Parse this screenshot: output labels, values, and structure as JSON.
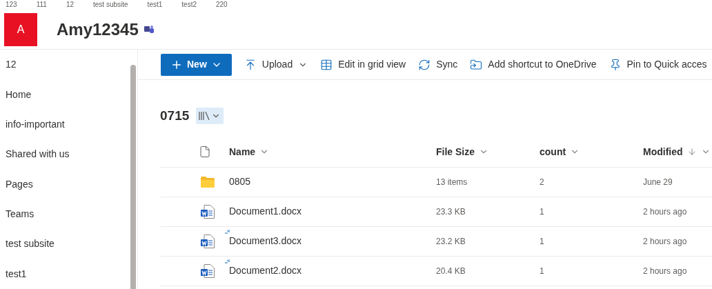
{
  "top_nav": [
    "123",
    "111",
    "12",
    "test subsite",
    "test1",
    "test2",
    "220"
  ],
  "site": {
    "logo_letter": "A",
    "title": "Amy12345"
  },
  "sidebar": {
    "items": [
      {
        "label": "12"
      },
      {
        "label": "Home"
      },
      {
        "label": "info-important"
      },
      {
        "label": "Shared with us"
      },
      {
        "label": "Pages"
      },
      {
        "label": "Teams"
      },
      {
        "label": "test subsite"
      },
      {
        "label": "test1"
      }
    ]
  },
  "toolbar": {
    "new_button": "New",
    "actions": [
      {
        "kind": "upload",
        "label": "Upload",
        "dropdown": true
      },
      {
        "kind": "grid",
        "label": "Edit in grid view",
        "dropdown": false
      },
      {
        "kind": "sync",
        "label": "Sync",
        "dropdown": false
      },
      {
        "kind": "shortcut",
        "label": "Add shortcut to OneDrive",
        "dropdown": false
      },
      {
        "kind": "pin",
        "label": "Pin to Quick acces",
        "dropdown": false
      }
    ]
  },
  "library": {
    "title": "0715"
  },
  "table": {
    "columns": [
      {
        "label": "Name",
        "sorted": false
      },
      {
        "label": "File Size",
        "sorted": false
      },
      {
        "label": "count",
        "sorted": false
      },
      {
        "label": "Modified",
        "sorted": true
      }
    ],
    "rows": [
      {
        "kind": "folder",
        "name": "0805",
        "new": false,
        "size": "13 items",
        "count": "2",
        "modified": "June 29"
      },
      {
        "kind": "word",
        "name": "Document1.docx",
        "new": false,
        "size": "23.3 KB",
        "count": "1",
        "modified": "2 hours ago"
      },
      {
        "kind": "word",
        "name": "Document3.docx",
        "new": true,
        "size": "23.2 KB",
        "count": "1",
        "modified": "2 hours ago"
      },
      {
        "kind": "word",
        "name": "Document2.docx",
        "new": true,
        "size": "20.4 KB",
        "count": "1",
        "modified": "2 hours ago"
      }
    ]
  }
}
